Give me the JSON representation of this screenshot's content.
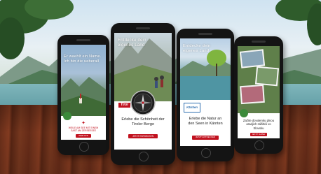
{
  "phones": [
    {
      "overlay_text": "Er waehlt ein Name. Ich bin die ueberall",
      "caption": "WEILE AM SEE MIT EINEM GAST AM ZERSEESEE",
      "button": "WEB APP"
    },
    {
      "overlay_text": "Entdecke dein eigenes Land",
      "logo": "Tirol",
      "caption": "Erlebe die Schönheit der Tiroler Berge",
      "button": "JETZT ENTDECKEN"
    },
    {
      "overlay_text": "Entdecke dein eigenes Land",
      "logo": "Kärnten",
      "caption": "Erlebe die Natur an den Seen in Kärnten",
      "button": "JETZT ENTDECKEN"
    },
    {
      "caption": "Zažite dovolenku plnou aradjich zážitků vo Slovsku",
      "button": "JETZT SUPER"
    }
  ],
  "colors": {
    "accent_red": "#c1121f",
    "badge_green": "#3b8a3a",
    "phone_body": "#141414"
  }
}
